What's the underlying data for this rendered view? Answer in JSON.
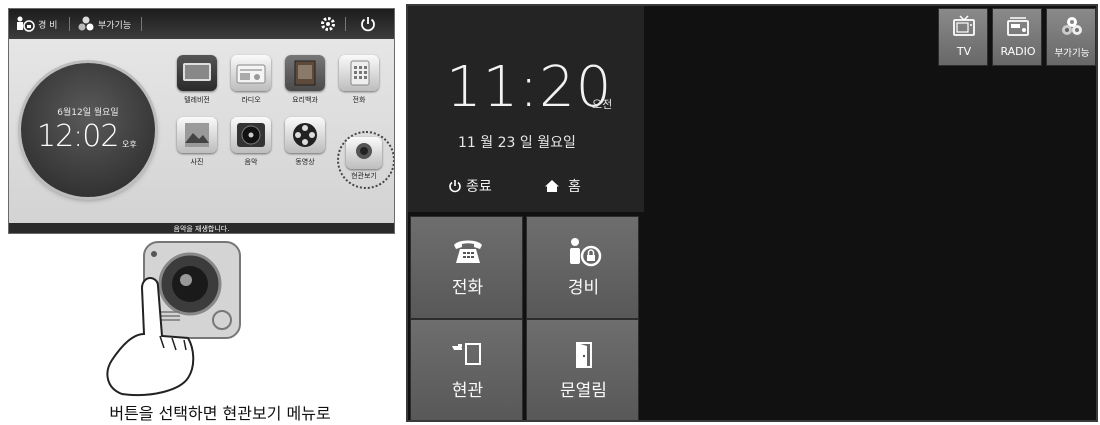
{
  "left": {
    "topbar": {
      "security_label": "경 비",
      "extra_label": "부가기능"
    },
    "clock": {
      "date": "6월12일 월요일",
      "time": "12:02",
      "ampm": "오후"
    },
    "apps": [
      {
        "label": "텔레비전"
      },
      {
        "label": "라디오"
      },
      {
        "label": "요리백과"
      },
      {
        "label": "전화"
      },
      {
        "label": "사진"
      },
      {
        "label": "음악"
      },
      {
        "label": "동영상"
      },
      {
        "label": "현관보기"
      }
    ],
    "status_text": "음악을 재생합니다.",
    "caption": "버튼을 선택하면 현관보기 메뉴로"
  },
  "right": {
    "clock": {
      "time": "11:20",
      "ampm": "오전",
      "date": "11 월 23 일 월요일"
    },
    "exit_label": "종료",
    "home_label": "홈",
    "tiles": [
      {
        "label": "전화",
        "icon": "telephone-icon"
      },
      {
        "label": "경비",
        "icon": "security-lock-icon"
      },
      {
        "label": "현관",
        "icon": "door-camera-icon"
      },
      {
        "label": "문열림",
        "icon": "door-open-icon"
      }
    ],
    "top_buttons": [
      {
        "label": "TV",
        "icon": "tv-icon"
      },
      {
        "label": "RADIO",
        "icon": "radio-icon"
      },
      {
        "label": "부가기능",
        "icon": "extra-features-icon"
      }
    ]
  },
  "colors": {
    "screen_dark": "#111111",
    "tile": "#606060",
    "panel": "#242424"
  }
}
